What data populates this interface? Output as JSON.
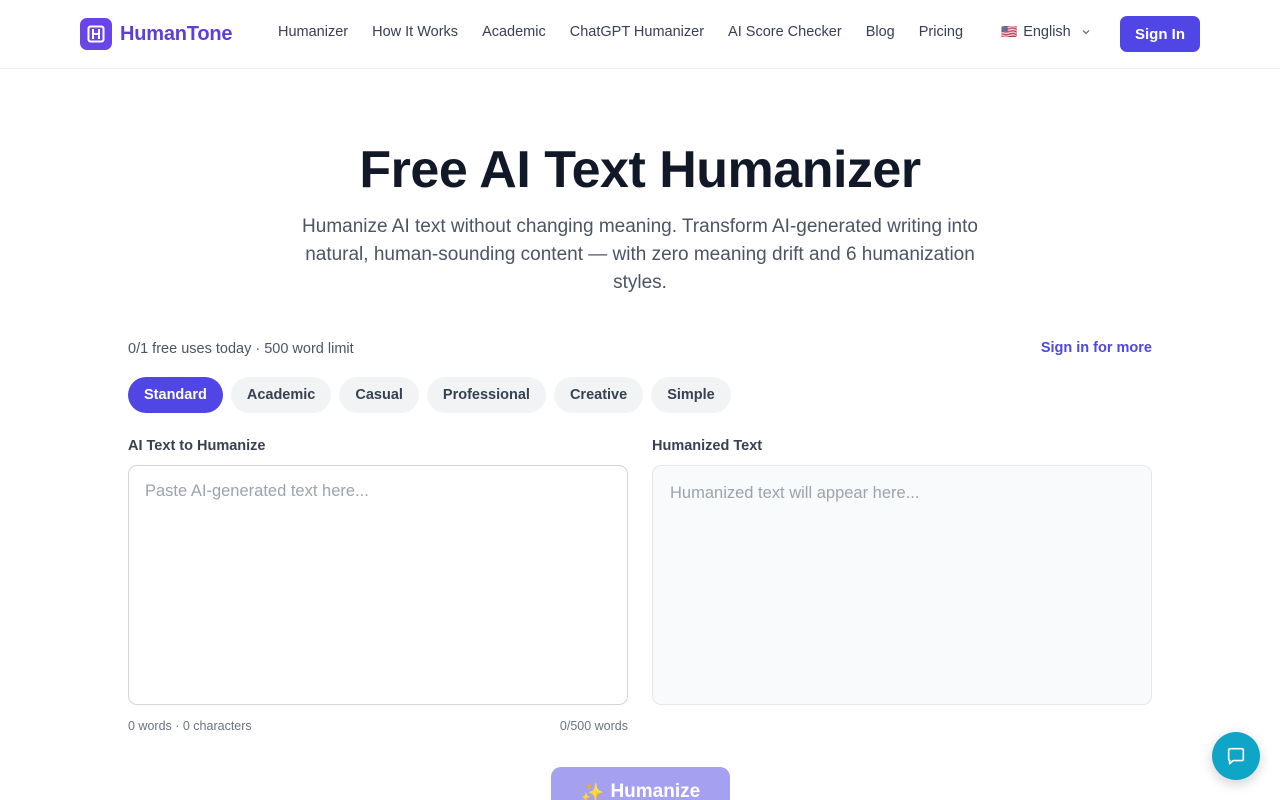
{
  "brand": {
    "name": "HumanTone",
    "accent": "#4f46e5",
    "logo_color": "#6a45e6"
  },
  "nav": {
    "items": [
      "Humanizer",
      "How It Works",
      "Academic",
      "ChatGPT Humanizer",
      "AI Score Checker",
      "Blog",
      "Pricing"
    ],
    "language": {
      "flag": "🇺🇸",
      "label": "English"
    },
    "sign_in": "Sign In"
  },
  "hero": {
    "title": "Free AI Text Humanizer",
    "subtitle": "Humanize AI text without changing meaning. Transform AI-generated writing into natural, human-sounding content — with zero meaning drift and 6 humanization styles."
  },
  "usage": {
    "text": "0/1 free uses today · 500 word limit",
    "link": "Sign in for more"
  },
  "modes": {
    "selected": "Standard",
    "items": [
      "Standard",
      "Academic",
      "Casual",
      "Professional",
      "Creative",
      "Simple"
    ]
  },
  "input": {
    "label": "AI Text to Humanize",
    "placeholder": "Paste AI-generated text here...",
    "value": "",
    "stats": "0 words · 0 characters",
    "limit": "0/500 words"
  },
  "output": {
    "label": "Humanized Text",
    "placeholder": "Humanized text will appear here..."
  },
  "action": {
    "icon": "✨",
    "label": "Humanize"
  },
  "chat": {
    "icon": "chat-bubble-icon",
    "color": "#0ea5c6"
  }
}
